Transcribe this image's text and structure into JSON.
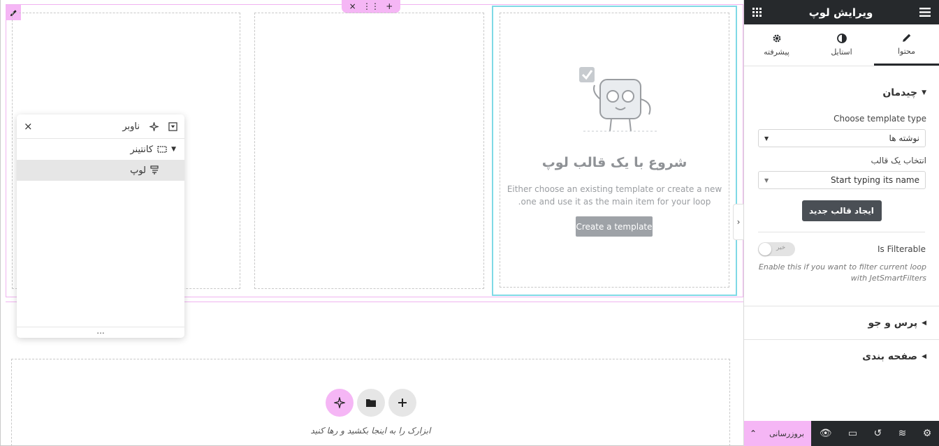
{
  "canvas": {
    "section_handle": {
      "add": "+",
      "drag": "⋮⋮",
      "close": "×"
    },
    "empty_state": {
      "title": "شروع با یک قالب لوپ",
      "description": "Either choose an existing template or create a new one and use it as the main item for your loop.",
      "create_button": "Create a template"
    },
    "drop_zone": {
      "text": "ابزارک را به اینجا بکشید و رها کنید"
    }
  },
  "navigator": {
    "title": "ناوبر",
    "items": [
      {
        "label": "کانتینر"
      },
      {
        "label": "لوپ"
      }
    ],
    "footer": "..."
  },
  "panel": {
    "title": "ویرایش لوپ",
    "tabs": [
      {
        "label": "محتوا",
        "icon": "pencil-icon"
      },
      {
        "label": "استایل",
        "icon": "contrast-icon"
      },
      {
        "label": "پیشرفته",
        "icon": "gear-icon"
      }
    ],
    "layout_section": {
      "title": "چیدمان",
      "template_type_label": "Choose template type",
      "template_type_value": "نوشته ها",
      "choose_template_label": "انتخاب یک قالب",
      "choose_template_placeholder": "Start typing its name",
      "new_template_button": "ایجاد قالب جدید",
      "filterable_label": "Is Filterable",
      "filterable_value": "خیر",
      "filterable_help": "Enable this if you want to filter current loop with JetSmartFilters"
    },
    "query_section": {
      "title": "پرس و جو"
    },
    "pagination_section": {
      "title": "صفحه بندی"
    },
    "footer": {
      "update_button": "بروزرسانی"
    }
  },
  "colors": {
    "accent_pink": "#f5b6f5",
    "selected_outline": "#7fd9e6",
    "panel_dark": "#26292c"
  }
}
